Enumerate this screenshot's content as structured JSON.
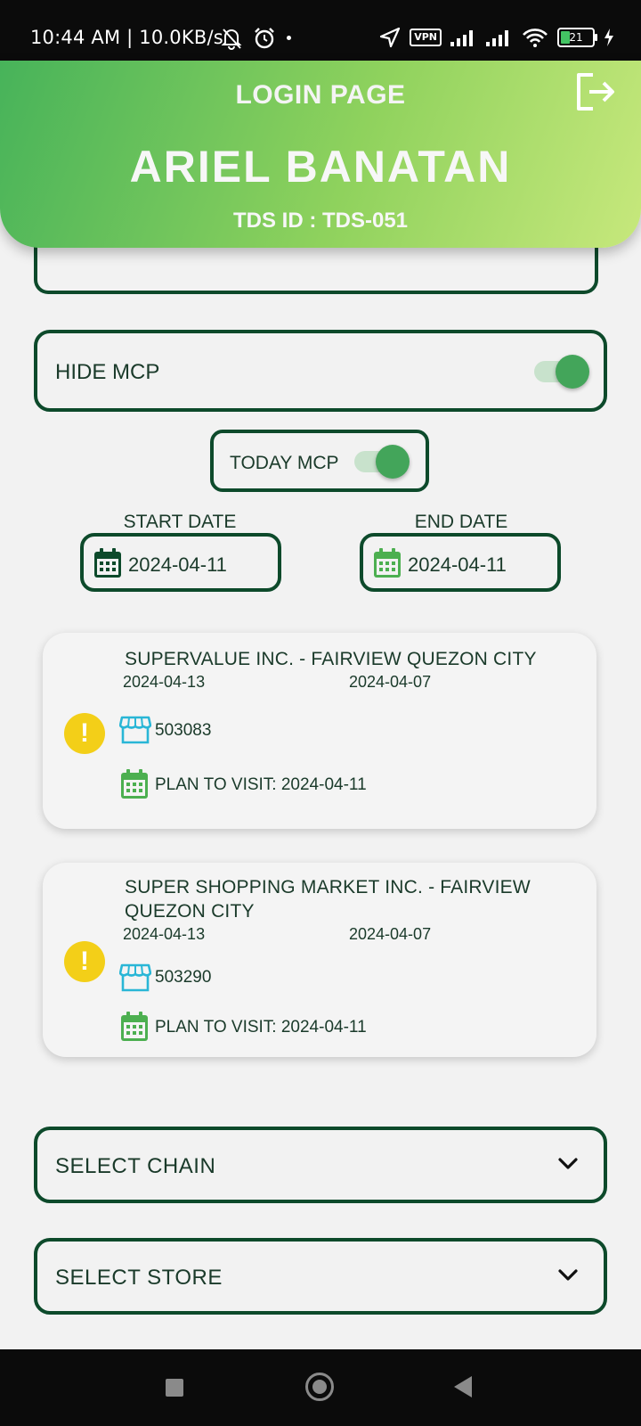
{
  "status_bar": {
    "time": "10:44 AM | 10.0KB/s",
    "vpn": "VPN",
    "battery": "21"
  },
  "header": {
    "title": "LOGIN PAGE",
    "name": "ARIEL BANATAN",
    "tds_id": "TDS ID : TDS-051",
    "logout_icon": "logout-icon"
  },
  "filters": {
    "hide_mcp_label": "HIDE MCP",
    "hide_mcp_on": true,
    "today_mcp_label": "TODAY MCP",
    "today_mcp_on": true,
    "start_date_label": "START DATE",
    "start_date": "2024-04-11",
    "end_date_label": "END DATE",
    "end_date": "2024-04-11"
  },
  "stores": [
    {
      "name": "SUPERVALUE INC. - FAIRVIEW QUEZON CITY",
      "date_1": "2024-04-13",
      "date_2": "2024-04-07",
      "code": "503083",
      "plan": "PLAN TO VISIT: 2024-04-11"
    },
    {
      "name": "SUPER SHOPPING MARKET INC. - FAIRVIEW QUEZON CITY",
      "date_1": "2024-04-13",
      "date_2": "2024-04-07",
      "code": "503290",
      "plan": "PLAN TO VISIT: 2024-04-11"
    }
  ],
  "selects": {
    "chain_label": "SELECT CHAIN",
    "store_label": "SELECT STORE"
  },
  "colors": {
    "accent_dark": "#0d4a2b",
    "header_start": "#47b35a",
    "header_end": "#c7e87c",
    "toggle_on": "#43a55a",
    "warning": "#f3cf18",
    "store_icon": "#29b6d6",
    "calendar_icon": "#4caf50"
  }
}
